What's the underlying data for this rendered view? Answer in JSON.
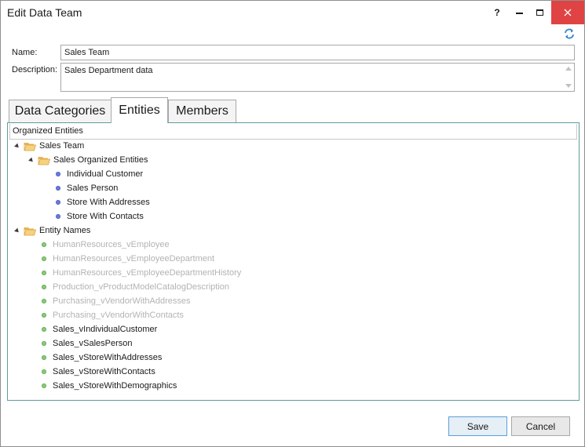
{
  "window": {
    "title": "Edit Data Team",
    "help_label": "?",
    "close_label": "✕"
  },
  "form": {
    "name_label": "Name:",
    "name_value": "Sales Team",
    "description_label": "Description:",
    "description_value": "Sales Department data"
  },
  "tabs": [
    {
      "label": "Data Categories",
      "selected": false
    },
    {
      "label": "Entities",
      "selected": true
    },
    {
      "label": "Members",
      "selected": false
    }
  ],
  "panel": {
    "header": "Organized Entities"
  },
  "tree": {
    "root1": {
      "label": "Sales Team",
      "child": {
        "label": "Sales Organized Entities",
        "items": [
          {
            "label": "Individual Customer"
          },
          {
            "label": "Sales Person"
          },
          {
            "label": "Store With Addresses"
          },
          {
            "label": "Store With Contacts"
          }
        ]
      }
    },
    "root2": {
      "label": "Entity Names",
      "items": [
        {
          "label": "HumanResources_vEmployee",
          "enabled": false
        },
        {
          "label": "HumanResources_vEmployeeDepartment",
          "enabled": false
        },
        {
          "label": "HumanResources_vEmployeeDepartmentHistory",
          "enabled": false
        },
        {
          "label": "Production_vProductModelCatalogDescription",
          "enabled": false
        },
        {
          "label": "Purchasing_vVendorWithAddresses",
          "enabled": false
        },
        {
          "label": "Purchasing_vVendorWithContacts",
          "enabled": false
        },
        {
          "label": "Sales_vIndividualCustomer",
          "enabled": true
        },
        {
          "label": "Sales_vSalesPerson",
          "enabled": true
        },
        {
          "label": "Sales_vStoreWithAddresses",
          "enabled": true
        },
        {
          "label": "Sales_vStoreWithContacts",
          "enabled": true
        },
        {
          "label": "Sales_vStoreWithDemographics",
          "enabled": true
        }
      ]
    }
  },
  "buttons": {
    "save_label": "Save",
    "cancel_label": "Cancel"
  },
  "icons": {
    "folder": "folder-open-icon",
    "refresh": "refresh-icon"
  },
  "colors": {
    "close_button_bg": "#e04343",
    "panel_border": "#5f9c9c",
    "entity_bullet": "#6b7ad6",
    "name_bullet": "#8cc87a",
    "folder": "#f0c46a",
    "accent": "#3a86d0"
  }
}
